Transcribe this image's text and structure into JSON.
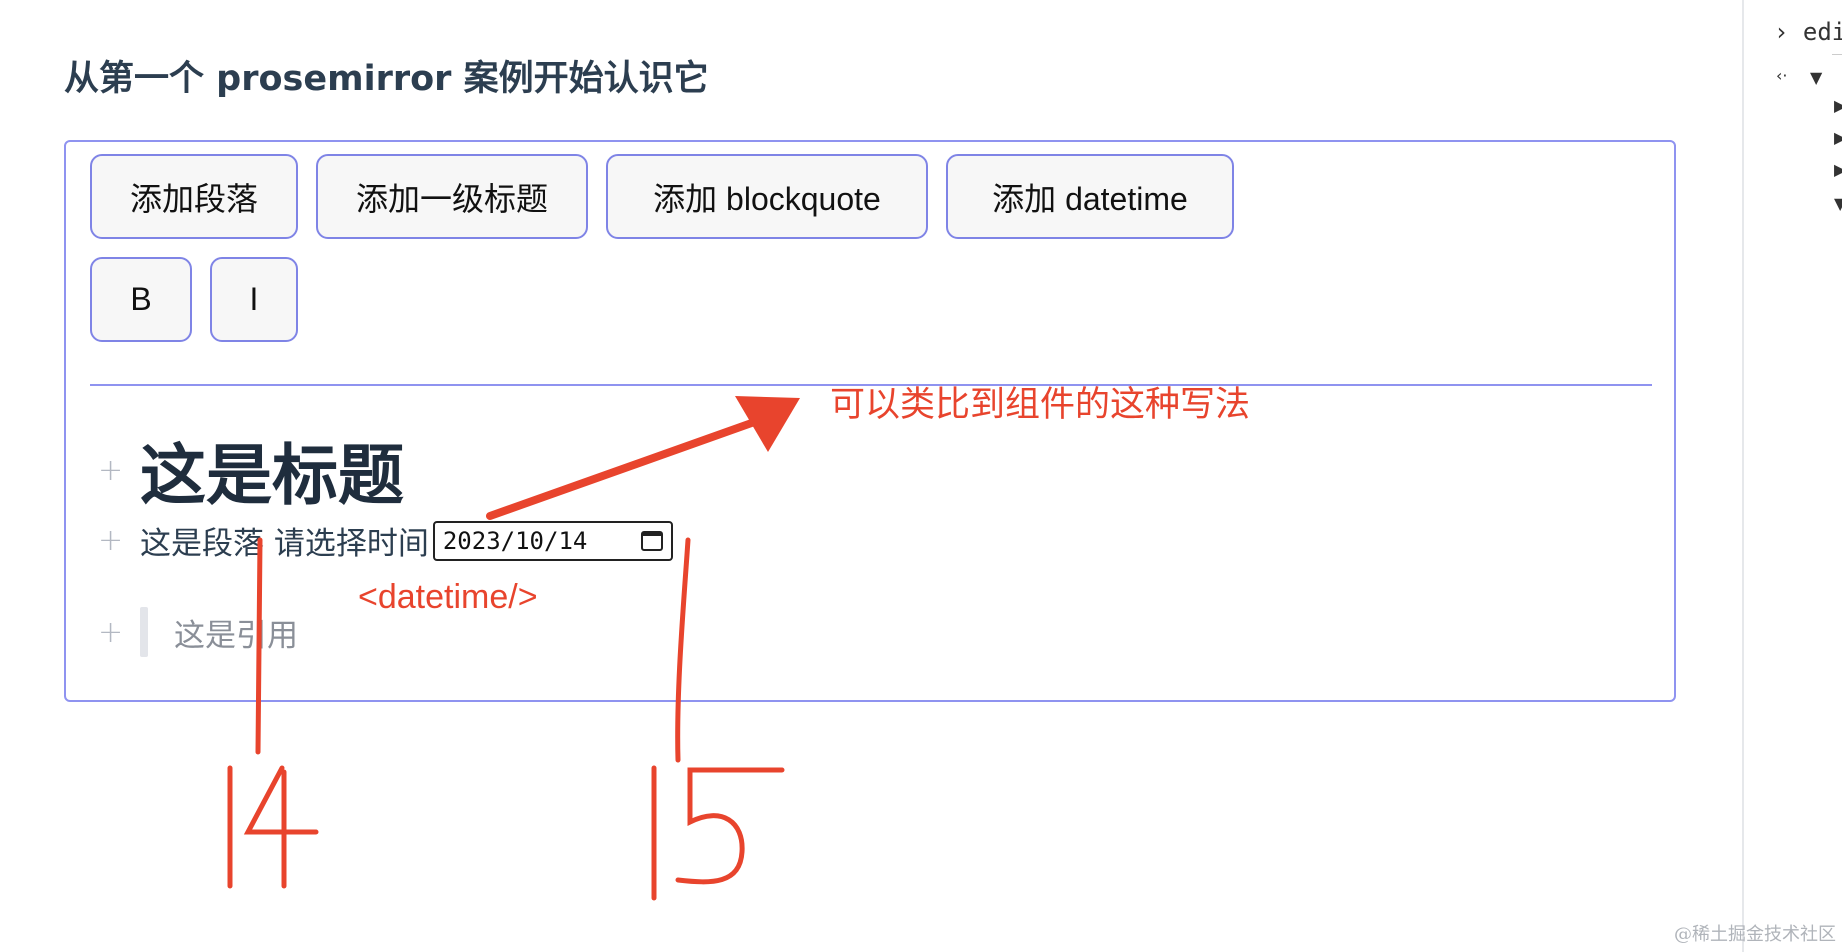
{
  "page": {
    "title": "从第一个 prosemirror 案例开始认识它"
  },
  "toolbar": {
    "add_paragraph": "添加段落",
    "add_heading": "添加一级标题",
    "add_blockquote": "添加 blockquote",
    "add_datetime": "添加 datetime",
    "bold": "B",
    "italic": "I"
  },
  "document": {
    "heading": "这是标题",
    "paragraph": "这是段落 请选择时间",
    "date_value": "2023/10/14",
    "blockquote": "这是引用",
    "add_block_symbol": "+"
  },
  "annotations": {
    "arrow_text": "可以类比到组件的这种写法",
    "tag_text": "<datetime/>",
    "color": "#e8442d"
  },
  "devtools": {
    "line1": "› edi"
  },
  "watermark": "@稀土掘金技术社区",
  "colors": {
    "border_accent": "#8f93f0",
    "button_bg": "#f7f7f7"
  }
}
